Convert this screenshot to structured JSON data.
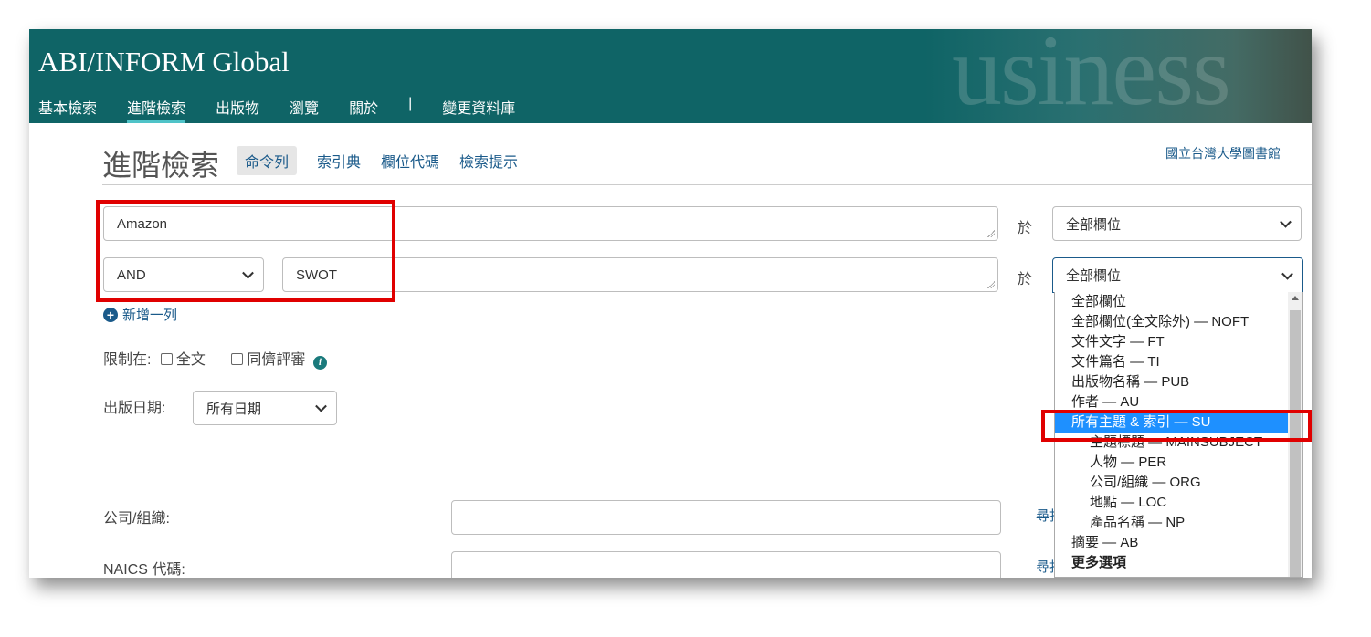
{
  "header": {
    "app_title": "ABI/INFORM Global",
    "nav": [
      "基本檢索",
      "進階檢索",
      "出版物",
      "瀏覽",
      "關於",
      "|",
      "變更資料庫"
    ]
  },
  "page": {
    "title": "進階檢索",
    "tabs": [
      "命令列",
      "索引典",
      "欄位代碼",
      "檢索提示"
    ],
    "library": "國立台灣大學圖書館"
  },
  "search": {
    "row1_term": "Amazon",
    "row1_in": "於",
    "row1_field": "全部欄位",
    "row2_operator": "AND",
    "row2_term": "SWOT",
    "row2_in": "於",
    "row2_field": "全部欄位",
    "add_row": "新增一列"
  },
  "limits": {
    "label": "限制在:",
    "fulltext": "全文",
    "peer_reviewed": "同儕評審"
  },
  "pubdate": {
    "label": "出版日期:",
    "value": "所有日期"
  },
  "company": {
    "label": "公司/組織:",
    "link": "尋找"
  },
  "naics": {
    "label": "NAICS 代碼:",
    "link": "尋找"
  },
  "field_dropdown": {
    "options": [
      "全部欄位",
      "全部欄位(全文除外) — NOFT",
      "文件文字 — FT",
      "文件篇名 — TI",
      "出版物名稱 — PUB",
      "作者 — AU",
      "所有主題 & 索引 — SU",
      "主題標題 — MAINSUBJECT",
      "人物 — PER",
      "公司/組織 — ORG",
      "地點 — LOC",
      "產品名稱 — NP",
      "摘要 — AB",
      "更多選項"
    ],
    "selected_index": 6
  },
  "colors": {
    "header_bg": "#0f6466",
    "link": "#1a5a8a",
    "highlight": "#e00000",
    "selected": "#1e90ff"
  }
}
